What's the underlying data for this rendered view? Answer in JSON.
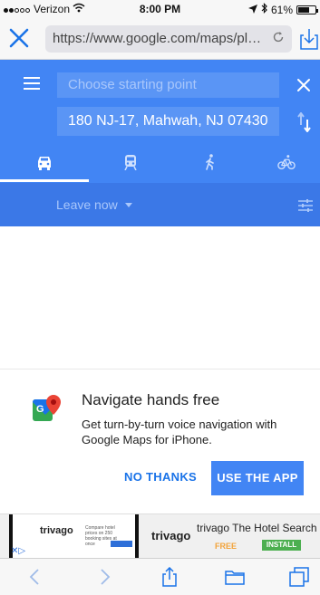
{
  "status_bar": {
    "carrier": "Verizon",
    "time": "8:00 PM",
    "battery": "61%",
    "battery_level": 0.61
  },
  "browser": {
    "url": "https://www.google.com/maps/plac..."
  },
  "maps": {
    "start_placeholder": "Choose starting point",
    "destination": "180 NJ-17, Mahwah, NJ 07430",
    "leave_label": "Leave now",
    "modes": [
      "drive",
      "transit",
      "walk",
      "bike"
    ],
    "selected_mode": "drive"
  },
  "promo": {
    "title": "Navigate hands free",
    "body": "Get turn-by-turn voice navigation with Google Maps for iPhone.",
    "no_thanks": "NO THANKS",
    "use_app": "USE THE APP"
  },
  "ad": {
    "logo": "trivago",
    "thumb_text": "Compare hotel prices on 250 booking sites at once",
    "title": "trivago The Hotel Search ...",
    "price": "FREE",
    "install": "INSTALL"
  },
  "colors": {
    "maps_blue": "#4285f4",
    "maps_dark_blue": "#3b78e7",
    "ios_blue": "#1a73e8",
    "install_green": "#4caf50"
  }
}
